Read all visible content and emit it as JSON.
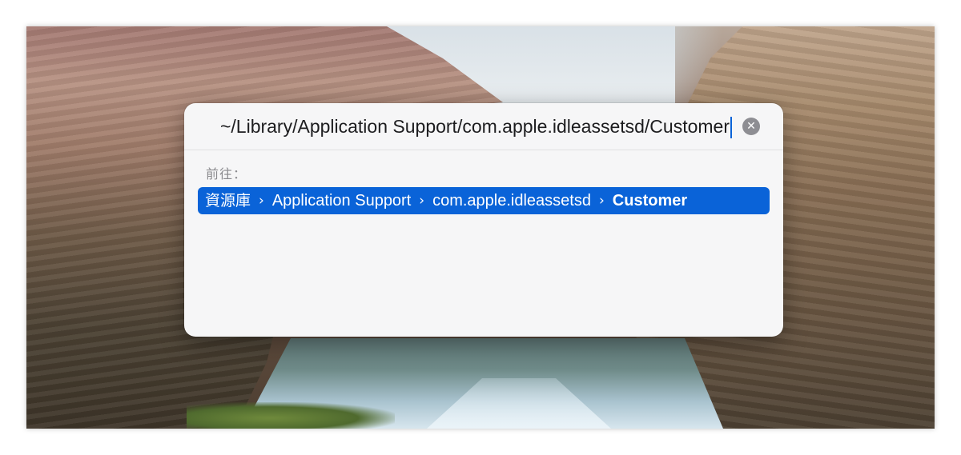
{
  "dialog": {
    "path_value": "~/Library/Application Support/com.apple.idleassetsd/Customer",
    "goto_label": "前往：",
    "clear_icon": "x-circle-icon",
    "suggestion": {
      "crumbs": [
        "資源庫",
        "Application Support",
        "com.apple.idleassetsd",
        "Customer"
      ],
      "separator": "›"
    }
  },
  "colors": {
    "accent": "#0a63d8",
    "dialog_bg": "#f6f6f7"
  }
}
